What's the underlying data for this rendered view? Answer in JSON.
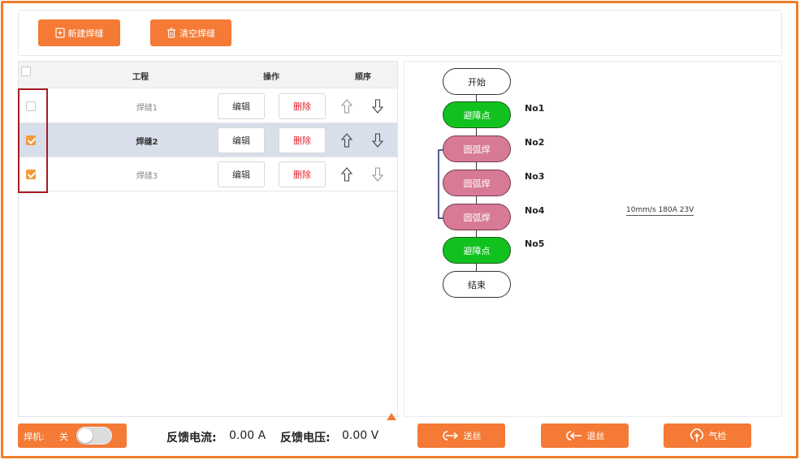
{
  "toolbar": {
    "new_weld_label": "新建焊缝",
    "clear_weld_label": "清空焊缝"
  },
  "table": {
    "columns": [
      "工程",
      "操作",
      "顺序"
    ],
    "rows": [
      {
        "name": "焊缝1",
        "checked": false,
        "selected": false,
        "edit_label": "编辑",
        "delete_label": "删除"
      },
      {
        "name": "焊缝2",
        "checked": true,
        "selected": true,
        "edit_label": "编辑",
        "delete_label": "删除"
      },
      {
        "name": "焊缝3",
        "checked": true,
        "selected": false,
        "edit_label": "编辑",
        "delete_label": "删除"
      }
    ]
  },
  "flow": {
    "nodes": [
      {
        "label": "开始",
        "kind": "white",
        "no": ""
      },
      {
        "label": "避障点",
        "kind": "green",
        "no": "No1"
      },
      {
        "label": "圆弧焊",
        "kind": "pink",
        "no": "No2"
      },
      {
        "label": "圆弧焊",
        "kind": "pink",
        "no": "No3"
      },
      {
        "label": "圆弧焊",
        "kind": "pink",
        "no": "No4"
      },
      {
        "label": "避障点",
        "kind": "green",
        "no": "No5"
      },
      {
        "label": "结束",
        "kind": "white",
        "no": ""
      }
    ],
    "weld_params": "10mm/s 180A 23V"
  },
  "status": {
    "welder_label": "焊机:",
    "welder_state": "关",
    "current_label": "反馈电流:",
    "current_value": "0.00 A",
    "voltage_label": "反馈电压:",
    "voltage_value": "0.00 V"
  },
  "actions": {
    "feed_wire": "送丝",
    "retract_wire": "退丝",
    "gas_check": "气检"
  },
  "colors": {
    "accent": "#f47a35",
    "node_green": "#11c21e",
    "node_pink": "#d67a95",
    "selected_row": "#d8deea",
    "highlight_box": "#a51c24"
  }
}
